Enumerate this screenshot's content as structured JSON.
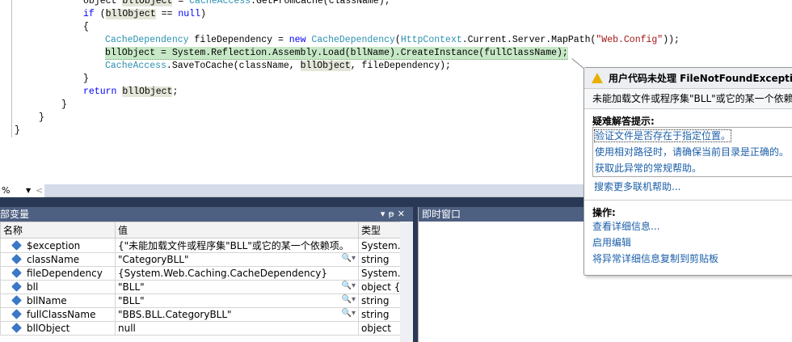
{
  "code": {
    "l1": {
      "a": "object ",
      "b": "bllObject",
      "c": " = ",
      "d": "CacheAccess",
      ".e": "",
      "e": ".GetFromCache(className);"
    },
    "l2": {
      "a": "if",
      "b": " (",
      "c": "bllObject",
      "d": " == ",
      "e": "null",
      "f": ")"
    },
    "l3": "{",
    "l4": {
      "a": "CacheDependency",
      "b": " fileDependency = ",
      "c": "new",
      "d": " ",
      "e": "CacheDependency",
      "f": "(",
      "g": "HttpContext",
      "h": ".Current.Server.MapPath(",
      "i": "\"Web.Config\"",
      "j": "));"
    },
    "l5": "bllObject = System.Reflection.Assembly.Load(bllName).CreateInstance(fullClassName);",
    "l6": {
      "a": "CacheAccess",
      "b": ".SaveToCache(className, ",
      "c": "bllObject",
      "d": ", fileDependency);"
    },
    "l7": "}",
    "l8": {
      "a": "return",
      "b": " ",
      "c": "bllObject",
      "d": ";"
    },
    "l9": "}",
    "l10": "}",
    "l11": "}"
  },
  "zoom": "%",
  "locals": {
    "title": "部变量",
    "columns": [
      "名称",
      "值",
      "类型"
    ],
    "rows": [
      {
        "name": "$exception",
        "value": "{\"未能加载文件或程序集\"BLL\"或它的某一个依赖项。",
        "type": "System.E"
      },
      {
        "name": "className",
        "value": "\"CategoryBLL\"",
        "type": "string"
      },
      {
        "name": "fileDependency",
        "value": "{System.Web.Caching.CacheDependency}",
        "type": "System.V"
      },
      {
        "name": "bll",
        "value": "\"BLL\"",
        "type": "object {s"
      },
      {
        "name": "bllName",
        "value": "\"BLL\"",
        "type": "string"
      },
      {
        "name": "fullClassName",
        "value": "\"BBS.BLL.CategoryBLL\"",
        "type": "string"
      },
      {
        "name": "bllObject",
        "value": "null",
        "type": "object"
      }
    ]
  },
  "immediate": {
    "title": "即时窗口"
  },
  "popup": {
    "title": "用户代码未处理 FileNotFoundException",
    "message": "未能加载文件或程序集\"BLL\"或它的某一个依赖项",
    "tips_heading": "疑难解答提示:",
    "tips": [
      "验证文件是否存在于指定位置。",
      "使用相对路径时，请确保当前目录是正确的。",
      "获取此异常的常规帮助。"
    ],
    "search_help": "搜索更多联机帮助...",
    "actions_heading": "操作:",
    "actions": [
      "查看详细信息...",
      "启用编辑",
      "将异常详细信息复制到剪贴板"
    ]
  }
}
